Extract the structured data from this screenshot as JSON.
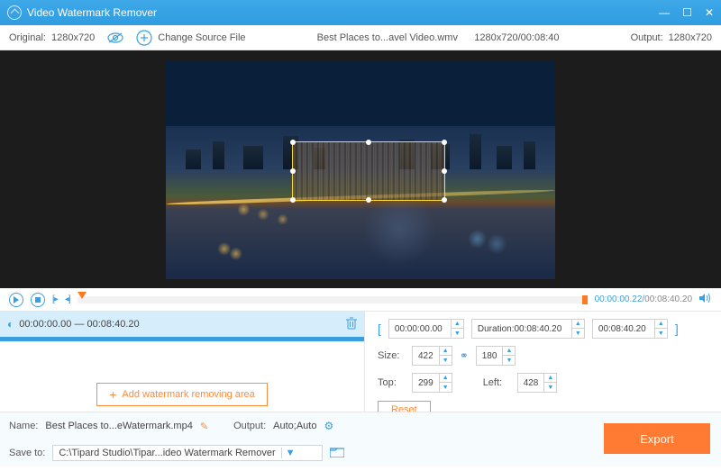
{
  "titlebar": {
    "title": "Video Watermark Remover"
  },
  "toolbar": {
    "original_label": "Original:",
    "original_res": "1280x720",
    "change_source": "Change Source File",
    "filename": "Best Places to...avel Video.wmv",
    "file_res_time": "1280x720/00:08:40",
    "output_label": "Output:",
    "output_res": "1280x720"
  },
  "playbar": {
    "current": "00:00:00.22",
    "total": "00:08:40.20"
  },
  "segment": {
    "start": "00:00:00.00",
    "sep": "—",
    "end": "00:08:40.20"
  },
  "add_area": "Add watermark removing area",
  "range": {
    "start": "00:00:00.00",
    "duration_label": "Duration:",
    "duration": "00:08:40.20",
    "end": "00:08:40.20"
  },
  "size": {
    "label": "Size:",
    "w": "422",
    "h": "180"
  },
  "pos": {
    "top_label": "Top:",
    "top": "299",
    "left_label": "Left:",
    "left": "428"
  },
  "reset": "Reset",
  "footer": {
    "name_label": "Name:",
    "name": "Best Places to...eWatermark.mp4",
    "output_label": "Output:",
    "output": "Auto;Auto",
    "save_label": "Save to:",
    "save_path": "C:\\Tipard Studio\\Tipar...ideo Watermark Remover"
  },
  "export": "Export"
}
